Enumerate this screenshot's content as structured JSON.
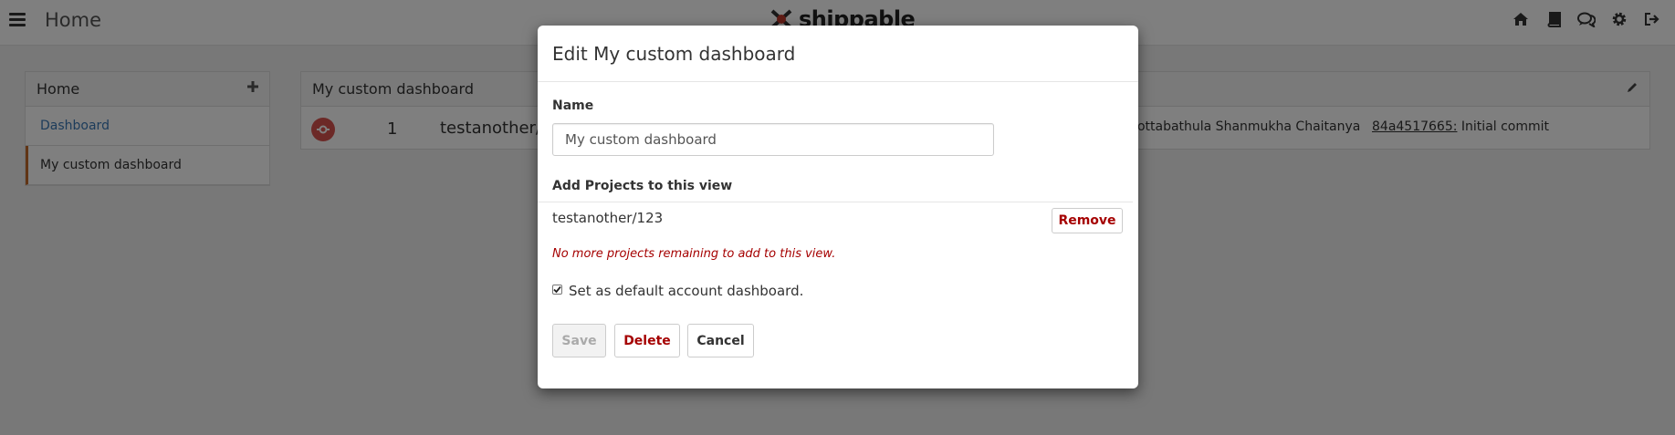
{
  "navbar": {
    "title": "Home",
    "brand": "shippable",
    "icons": [
      "home-icon",
      "book-icon",
      "chat-icon",
      "gear-icon",
      "sign-out-icon"
    ]
  },
  "sidebar": {
    "title": "Home",
    "items": [
      {
        "label": "Dashboard"
      },
      {
        "label": "My custom dashboard"
      }
    ]
  },
  "panel": {
    "title": "My custom dashboard",
    "row": {
      "number": "1",
      "project": "testanother/123",
      "author": "Pottabathula Shanmukha Chaitanya",
      "commit_sha": "84a4517665:",
      "commit_msg": " Initial commit"
    }
  },
  "modal": {
    "title": "Edit My custom dashboard",
    "name_label": "Name",
    "name_value": "My custom dashboard",
    "projects_label": "Add Projects to this view",
    "project": "testanother/123",
    "remove_label": "Remove",
    "note": "No more projects remaining to add to this view.",
    "default_label": "Set as default account dashboard.",
    "default_checked": true,
    "save_label": "Save",
    "delete_label": "Delete",
    "cancel_label": "Cancel"
  },
  "colors": {
    "link": "#3a79b6",
    "danger": "#a50000",
    "status_failed": "#d9534f",
    "active_marker": "#c36a2b"
  }
}
